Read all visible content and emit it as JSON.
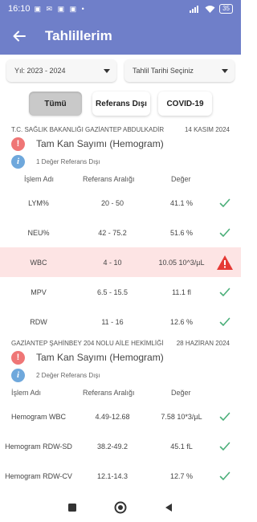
{
  "status_bar": {
    "time": "16:10",
    "notification_icons": "▣ ✉ ▣ ▣ •",
    "battery": "35"
  },
  "app_bar": {
    "title": "Tahlillerim"
  },
  "filters": {
    "year": "Yıl: 2023 - 2024",
    "date": "Tahlil Tarihi Seçiniz"
  },
  "tabs": [
    {
      "label": "Tümü",
      "active": true
    },
    {
      "label": "Referans Dışı",
      "active": false
    },
    {
      "label": "COVID-19",
      "active": false
    }
  ],
  "columns": {
    "name": "İşlem Adı",
    "range": "Referans Aralığı",
    "value": "Değer"
  },
  "sections": [
    {
      "institution": "T.C. SAĞLIK BAKANLIĞI GAZİANTEP ABDULKADİR",
      "date": "14 KASIM 2024",
      "test_name": "Tam Kan Sayımı (Hemogram)",
      "note": "1 Değer Referans Dışı",
      "rows": [
        {
          "name": "LYM%",
          "range": "20 - 50",
          "value": "41.1 %",
          "status": "ok"
        },
        {
          "name": "NEU%",
          "range": "42 - 75.2",
          "value": "51.6 %",
          "status": "ok"
        },
        {
          "name": "WBC",
          "range": "4 - 10",
          "value": "10.05 10^3/µL",
          "status": "out"
        },
        {
          "name": "MPV",
          "range": "6.5 - 15.5",
          "value": "11.1 fl",
          "status": "ok"
        },
        {
          "name": "RDW",
          "range": "11 - 16",
          "value": "12.6 %",
          "status": "ok"
        }
      ]
    },
    {
      "institution": "GAZİANTEP ŞAHİNBEY 204 NOLU AİLE HEKİMLİĞİ",
      "date": "28 HAZİRAN 2024",
      "test_name": "Tam Kan Sayımı (Hemogram)",
      "note": "2 Değer Referans Dışı",
      "rows": [
        {
          "name": "Hemogram WBC",
          "range": "4.49-12.68",
          "value": "7.58 10*3/µL",
          "status": "ok"
        },
        {
          "name": "Hemogram RDW-SD",
          "range": "38.2-49.2",
          "value": "45.1 fL",
          "status": "ok"
        },
        {
          "name": "Hemogram RDW-CV",
          "range": "12.1-14.3",
          "value": "12.7 %",
          "status": "ok"
        }
      ]
    }
  ],
  "colors": {
    "primary": "#6f7fc9",
    "alert_bg": "#fde4e4",
    "ok_check": "#4caf7a",
    "warning": "#e53935"
  },
  "icons": {
    "back": "arrow-left-icon",
    "ok": "check-icon",
    "out": "warning-triangle-icon",
    "alert": "exclamation-circle-icon",
    "info": "info-circle-icon"
  }
}
